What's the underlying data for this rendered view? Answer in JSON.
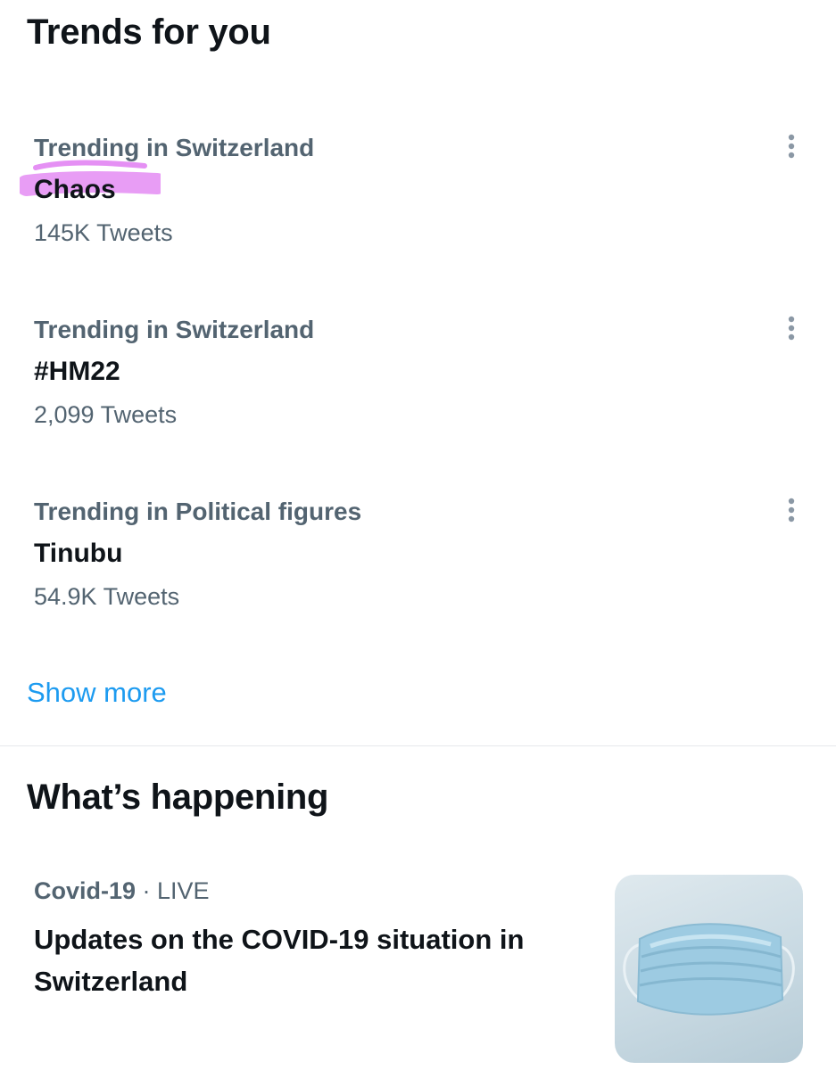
{
  "trends": {
    "title": "Trends for you",
    "items": [
      {
        "context": "Trending in Switzerland",
        "name": "Chaos",
        "count": "145K Tweets",
        "highlighted": true
      },
      {
        "context": "Trending in Switzerland",
        "name": "#HM22",
        "count": "2,099 Tweets",
        "highlighted": false
      },
      {
        "context": "Trending in Political figures",
        "name": "Tinubu",
        "count": "54.9K Tweets",
        "highlighted": false
      }
    ],
    "show_more": "Show more"
  },
  "happening": {
    "title": "What’s happening",
    "item": {
      "topic": "Covid-19",
      "separator": " · ",
      "status": "LIVE",
      "headline": "Updates on the COVID-19 situation in Switzerland",
      "image_icon": "face-mask-image"
    }
  },
  "colors": {
    "primary_text": "#0f1419",
    "secondary_text": "#536471",
    "accent": "#1d9bf0",
    "highlight": "#e07cf2"
  }
}
